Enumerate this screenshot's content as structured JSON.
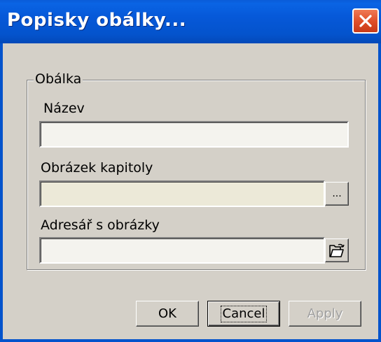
{
  "window": {
    "title": "Popisky obálky...",
    "close_icon": "close-icon"
  },
  "group": {
    "label": "Obálka"
  },
  "fields": {
    "name_label": "Název",
    "name_value": "",
    "chapter_image_label": "Obrázek kapitoly",
    "chapter_image_value": "",
    "browse_label": "...",
    "image_dir_label": "Adresář s obrázky",
    "image_dir_value": "",
    "folder_icon": "folder-open-icon"
  },
  "buttons": {
    "ok": "OK",
    "cancel": "Cancel",
    "apply": "Apply",
    "apply_enabled": false
  }
}
